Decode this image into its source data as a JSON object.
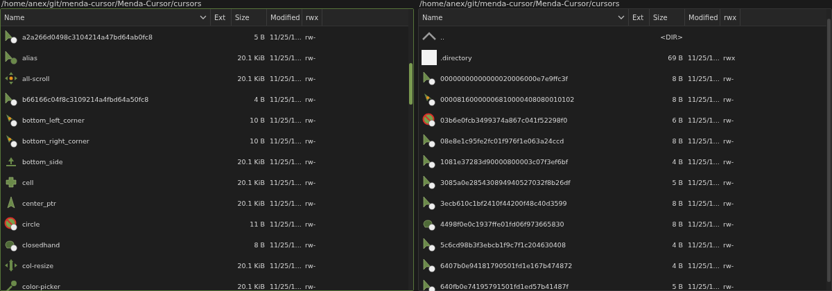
{
  "panes": [
    {
      "path": "/home/anex/git/menda-cursor/Menda-Cursor/cursors",
      "selected": true,
      "columns": [
        "Name",
        "Ext",
        "Size",
        "Modified",
        "rwx"
      ],
      "rows": [
        {
          "kind": "pointer",
          "name": "a2a266d0498c3104214a47bd64ab0fc8",
          "size": "5 B",
          "modified": "11/25/1...",
          "rwx": "rw-"
        },
        {
          "kind": "alias",
          "name": "alias",
          "size": "20.1 KiB",
          "modified": "11/25/1...",
          "rwx": "rw-"
        },
        {
          "kind": "move",
          "name": "all-scroll",
          "size": "20.1 KiB",
          "modified": "11/25/1...",
          "rwx": "rw-"
        },
        {
          "kind": "pointer",
          "name": "b66166c04f8c3109214a4fbd64a50fc8",
          "size": "4 B",
          "modified": "11/25/1...",
          "rwx": "rw-"
        },
        {
          "kind": "corner",
          "name": "bottom_left_corner",
          "size": "10 B",
          "modified": "11/25/1...",
          "rwx": "rw-"
        },
        {
          "kind": "corner",
          "name": "bottom_right_corner",
          "size": "10 B",
          "modified": "11/25/1...",
          "rwx": "rw-"
        },
        {
          "kind": "side",
          "name": "bottom_side",
          "size": "20.1 KiB",
          "modified": "11/25/1...",
          "rwx": "rw-"
        },
        {
          "kind": "cell",
          "name": "cell",
          "size": "20.1 KiB",
          "modified": "11/25/1...",
          "rwx": "rw-"
        },
        {
          "kind": "center",
          "name": "center_ptr",
          "size": "20.1 KiB",
          "modified": "11/25/1...",
          "rwx": "rw-"
        },
        {
          "kind": "forbidden",
          "name": "circle",
          "size": "11 B",
          "modified": "11/25/1...",
          "rwx": "rw-"
        },
        {
          "kind": "hand",
          "name": "closedhand",
          "size": "8 B",
          "modified": "11/25/1...",
          "rwx": "rw-"
        },
        {
          "kind": "resize",
          "name": "col-resize",
          "size": "20.1 KiB",
          "modified": "11/25/1...",
          "rwx": "rw-"
        },
        {
          "kind": "picker",
          "name": "color-picker",
          "size": "20.1 KiB",
          "modified": "11/25/1...",
          "rwx": "rw-"
        }
      ]
    },
    {
      "path": "/home/anex/git/menda-cursor/Menda-Cursor/cursors",
      "selected": false,
      "columns": [
        "Name",
        "Ext",
        "Size",
        "Modified",
        "rwx"
      ],
      "rows": [
        {
          "kind": "parent",
          "name": "..",
          "size": "<DIR>"
        },
        {
          "kind": "thumbnail",
          "name": ".directory",
          "size": "69 B",
          "modified": "11/25/1...",
          "rwx": "rwx"
        },
        {
          "kind": "pointer",
          "name": "00000000000000020006000e7e9ffc3f",
          "size": "8 B",
          "modified": "11/25/1...",
          "rwx": "rw-"
        },
        {
          "kind": "corner",
          "name": "00008160000006810000408080010102",
          "size": "8 B",
          "modified": "11/25/1...",
          "rwx": "rw-"
        },
        {
          "kind": "forbidden",
          "name": "03b6e0fcb3499374a867c041f52298f0",
          "size": "6 B",
          "modified": "11/25/1...",
          "rwx": "rw-"
        },
        {
          "kind": "pointer",
          "name": "08e8e1c95fe2fc01f976f1e063a24ccd",
          "size": "8 B",
          "modified": "11/25/1...",
          "rwx": "rw-"
        },
        {
          "kind": "pointer",
          "name": "1081e37283d90000800003c07f3ef6bf",
          "size": "4 B",
          "modified": "11/25/1...",
          "rwx": "rw-"
        },
        {
          "kind": "pointer",
          "name": "3085a0e285430894940527032f8b26df",
          "size": "5 B",
          "modified": "11/25/1...",
          "rwx": "rw-"
        },
        {
          "kind": "pointer",
          "name": "3ecb610c1bf2410f44200f48c40d3599",
          "size": "8 B",
          "modified": "11/25/1...",
          "rwx": "rw-"
        },
        {
          "kind": "hand",
          "name": "4498f0e0c1937ffe01fd06f973665830",
          "size": "8 B",
          "modified": "11/25/1...",
          "rwx": "rw-"
        },
        {
          "kind": "pointer",
          "name": "5c6cd98b3f3ebcb1f9c7f1c204630408",
          "size": "4 B",
          "modified": "11/25/1...",
          "rwx": "rw-"
        },
        {
          "kind": "pointer",
          "name": "6407b0e94181790501fd1e167b474872",
          "size": "4 B",
          "modified": "11/25/1...",
          "rwx": "rw-"
        },
        {
          "kind": "pointer",
          "name": "640fb0e74195791501fd1ed57b41487f",
          "size": "5 B",
          "modified": "11/25/1...",
          "rwx": "rw-"
        }
      ]
    }
  ]
}
